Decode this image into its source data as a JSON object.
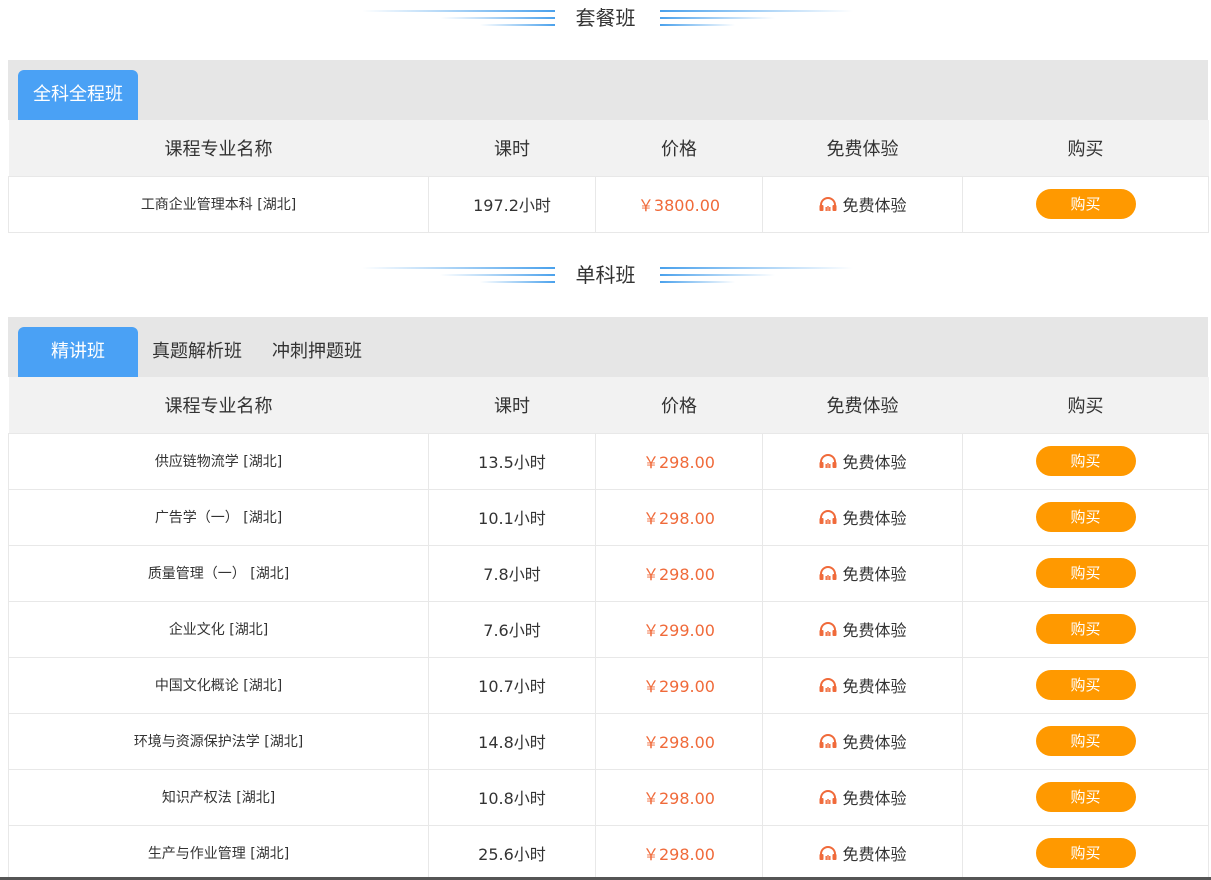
{
  "package_section": {
    "title": "套餐班",
    "tabs": [
      "全科全程班"
    ],
    "headers": [
      "课程专业名称",
      "课时",
      "价格",
      "免费体验",
      "购买"
    ],
    "rows": [
      {
        "name": "工商企业管理本科 [湖北]",
        "hours": "197.2小时",
        "price": "￥3800.00",
        "trial": "免费体验",
        "buy": "购买"
      }
    ]
  },
  "single_section": {
    "title": "单科班",
    "tabs": [
      "精讲班",
      "真题解析班",
      "冲刺押题班"
    ],
    "headers": [
      "课程专业名称",
      "课时",
      "价格",
      "免费体验",
      "购买"
    ],
    "rows": [
      {
        "name": "供应链物流学 [湖北]",
        "hours": "13.5小时",
        "price": "￥298.00",
        "trial": "免费体验",
        "buy": "购买"
      },
      {
        "name": "广告学（一） [湖北]",
        "hours": "10.1小时",
        "price": "￥298.00",
        "trial": "免费体验",
        "buy": "购买"
      },
      {
        "name": "质量管理（一） [湖北]",
        "hours": "7.8小时",
        "price": "￥298.00",
        "trial": "免费体验",
        "buy": "购买"
      },
      {
        "name": "企业文化 [湖北]",
        "hours": "7.6小时",
        "price": "￥299.00",
        "trial": "免费体验",
        "buy": "购买"
      },
      {
        "name": "中国文化概论 [湖北]",
        "hours": "10.7小时",
        "price": "￥299.00",
        "trial": "免费体验",
        "buy": "购买"
      },
      {
        "name": "环境与资源保护法学 [湖北]",
        "hours": "14.8小时",
        "price": "￥298.00",
        "trial": "免费体验",
        "buy": "购买"
      },
      {
        "name": "知识产权法 [湖北]",
        "hours": "10.8小时",
        "price": "￥298.00",
        "trial": "免费体验",
        "buy": "购买"
      },
      {
        "name": "生产与作业管理 [湖北]",
        "hours": "25.6小时",
        "price": "￥298.00",
        "trial": "免费体验",
        "buy": "购买"
      }
    ]
  },
  "colors": {
    "accent_blue": "#4aa1f5",
    "price_red": "#f06a3a",
    "buy_orange": "#ff9900",
    "icon_orange": "#f06a3a"
  },
  "icons": {
    "trial_icon": "headset-icon"
  }
}
